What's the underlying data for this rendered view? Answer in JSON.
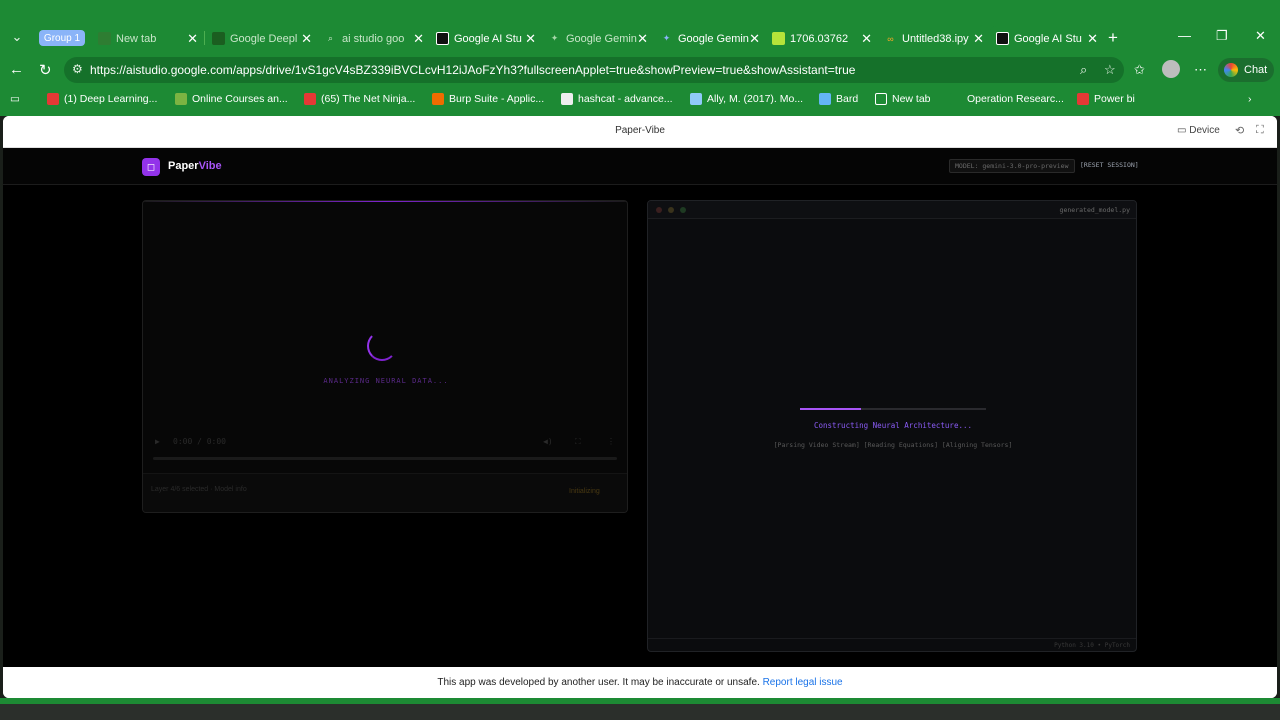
{
  "browser": {
    "group_label": "Group 1",
    "tabs": [
      {
        "title": "New tab",
        "fav_color": "#2e7d32"
      },
      {
        "title": "Google Deepl",
        "fav_color": "#1b5e20"
      },
      {
        "title": "ai studio goo",
        "fav_color": "#1b5e20"
      },
      {
        "title": "Google AI Stu",
        "fav_color": "#111111"
      },
      {
        "title": "Google Gemin",
        "fav_color": "#1b5e20"
      },
      {
        "title": "Google Gemin",
        "fav_color": "#4285f4"
      },
      {
        "title": "1706.03762",
        "fav_color": "#b6e33a"
      },
      {
        "title": "Untitled38.ipy",
        "fav_color": "#f9a825"
      },
      {
        "title": "Google AI Stu",
        "fav_color": "#111111"
      }
    ],
    "url": "https://aistudio.google.com/apps/drive/1vS1gcV4sBZ339iBVCLcvH12iJAoFzYh3?fullscreenApplet=true&showPreview=true&showAssistant=true",
    "chat_label": "Chat",
    "bookmarks": [
      {
        "label": "(1) Deep Learning...",
        "color": "#e53935"
      },
      {
        "label": "Online Courses an...",
        "color": "#7cb342"
      },
      {
        "label": "(65) The Net Ninja...",
        "color": "#e53935"
      },
      {
        "label": "Burp Suite - Applic...",
        "color": "#ef6c00"
      },
      {
        "label": "hashcat - advance...",
        "color": "#eeeeee"
      },
      {
        "label": "Ally, M. (2017). Mo...",
        "color": "#90caf9"
      },
      {
        "label": "Bard",
        "color": "#64b5f6"
      },
      {
        "label": "New tab",
        "color": "#1d8a34"
      },
      {
        "label": "Operation Researc...",
        "color": "#1d8a34"
      },
      {
        "label": "Power bi",
        "color": "#e53935"
      }
    ]
  },
  "frame": {
    "title": "Paper-Vibe",
    "device_label": "Device"
  },
  "app": {
    "logo_initial": "◻",
    "logo_part1": "Paper",
    "logo_part2": "Vibe",
    "model_chip": "MODEL: gemini-3.0-pro-preview",
    "reset_label": "[RESET SESSION]",
    "video": {
      "status": "ANALYZING NEURAL DATA...",
      "time": "0:00 / 0:00",
      "footer_left": "Layer 4/6 selected · Model info",
      "footer_right": "Initializing"
    },
    "code": {
      "filename": "generated_model.py",
      "status": "Constructing Neural Architecture...",
      "steps": "[Parsing Video Stream] [Reading Equations] [Aligning Tensors]",
      "python_version": "Python 3.10 • PyTorch",
      "progress": 0.33
    }
  },
  "notice": {
    "text": "This app was developed by another user. It may be inaccurate or unsafe.",
    "link": "Report legal issue"
  }
}
